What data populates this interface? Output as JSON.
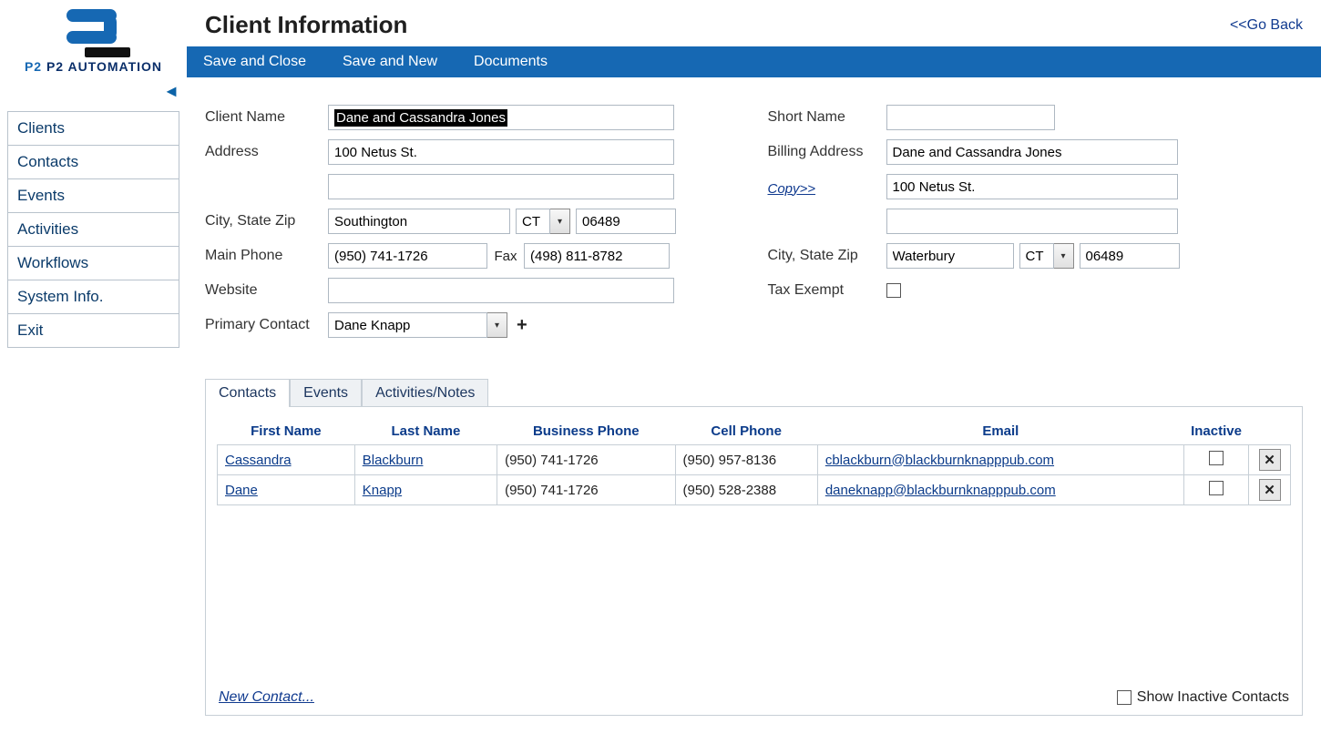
{
  "brand": {
    "name": "P2 AUTOMATION"
  },
  "header": {
    "title": "Client Information",
    "go_back": "<<Go Back"
  },
  "toolbar": {
    "save_close": "Save and Close",
    "save_new": "Save and New",
    "documents": "Documents"
  },
  "sidebar": {
    "items": [
      "Clients",
      "Contacts",
      "Events",
      "Activities",
      "Workflows",
      "System Info.",
      "Exit"
    ],
    "selected": 0
  },
  "form": {
    "labels": {
      "client_name": "Client Name",
      "address": "Address",
      "city_state_zip": "City, State Zip",
      "main_phone": "Main Phone",
      "fax": "Fax",
      "website": "Website",
      "primary_contact": "Primary Contact",
      "short_name": "Short Name",
      "billing_address": "Billing Address",
      "copy": "Copy>>",
      "tax_exempt": "Tax Exempt"
    },
    "client_name": "Dane and Cassandra Jones",
    "address1": "100 Netus St.",
    "address2": "",
    "city": "Southington",
    "state": "CT",
    "zip": "06489",
    "main_phone": "(950) 741-1726",
    "fax": "(498) 811-8782",
    "website": "",
    "primary_contact": "Dane Knapp",
    "short_name": "",
    "bill_name": "Dane and Cassandra Jones",
    "bill_addr1": "100 Netus St.",
    "bill_addr2": "",
    "bill_city": "Waterbury",
    "bill_state": "CT",
    "bill_zip": "06489",
    "tax_exempt": false
  },
  "tabs": {
    "list": [
      "Contacts",
      "Events",
      "Activities/Notes"
    ],
    "active": 0
  },
  "contacts_grid": {
    "headers": {
      "first": "First Name",
      "last": "Last Name",
      "bphone": "Business Phone",
      "cphone": "Cell Phone",
      "email": "Email",
      "inactive": "Inactive"
    },
    "rows": [
      {
        "first": "Cassandra",
        "last": "Blackburn",
        "bphone": "(950) 741-1726",
        "cphone": "(950) 957-8136",
        "email": "cblackburn@blackburnknapppub.com",
        "inactive": false
      },
      {
        "first": "Dane",
        "last": "Knapp",
        "bphone": "(950) 741-1726",
        "cphone": "(950) 528-2388",
        "email": "daneknapp@blackburnknapppub.com",
        "inactive": false
      }
    ],
    "new_contact": "New Contact...",
    "show_inactive_label": "Show Inactive Contacts",
    "show_inactive": false
  }
}
